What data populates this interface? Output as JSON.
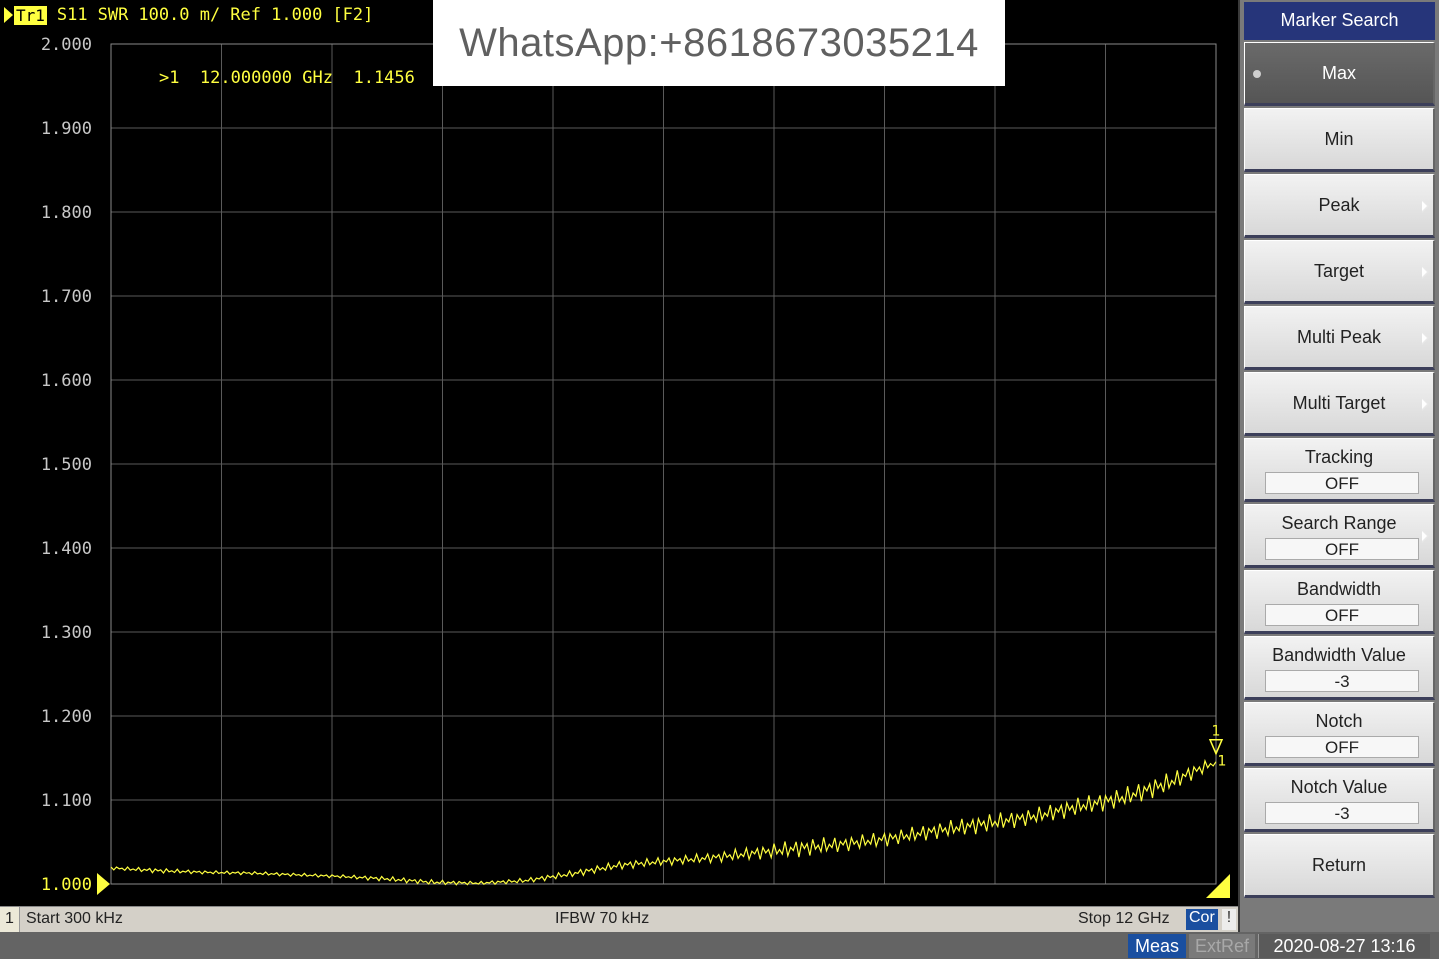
{
  "header": {
    "trace_tag": "Tr1",
    "measurement": "S11",
    "format": "SWR",
    "scale": "100.0 m/",
    "reference": "Ref 1.000",
    "function_key": "[F2]"
  },
  "watermark": "WhatsApp:+8618673035214",
  "marker": {
    "number": ">1",
    "frequency": "12.000000 GHz",
    "value": "1.1456",
    "tag_top": "1",
    "tag_bottom": "1"
  },
  "status_bar": {
    "channel": "1",
    "start": "Start 300 kHz",
    "ifbw": "IFBW 70 kHz",
    "stop": "Stop 12 GHz",
    "correction": "Cor",
    "warning": "!"
  },
  "bottom_bar": {
    "meas": "Meas",
    "extref": "ExtRef",
    "datetime": "2020-08-27 13:16"
  },
  "softkeys": {
    "title": "Marker Search",
    "items": [
      {
        "label": "Max",
        "value": null,
        "submenu": false,
        "active": true
      },
      {
        "label": "Min",
        "value": null,
        "submenu": false,
        "active": false
      },
      {
        "label": "Peak",
        "value": null,
        "submenu": true,
        "active": false
      },
      {
        "label": "Target",
        "value": null,
        "submenu": true,
        "active": false
      },
      {
        "label": "Multi Peak",
        "value": null,
        "submenu": true,
        "active": false
      },
      {
        "label": "Multi Target",
        "value": null,
        "submenu": true,
        "active": false
      },
      {
        "label": "Tracking",
        "value": "OFF",
        "submenu": false,
        "active": false
      },
      {
        "label": "Search Range",
        "value": "OFF",
        "submenu": true,
        "active": false
      },
      {
        "label": "Bandwidth",
        "value": "OFF",
        "submenu": false,
        "active": false
      },
      {
        "label": "Bandwidth Value",
        "value": "-3",
        "submenu": false,
        "active": false
      },
      {
        "label": "Notch",
        "value": "OFF",
        "submenu": false,
        "active": false
      },
      {
        "label": "Notch Value",
        "value": "-3",
        "submenu": false,
        "active": false
      },
      {
        "label": "Return",
        "value": null,
        "submenu": false,
        "active": false
      }
    ]
  },
  "colors": {
    "trace": "#ffff40",
    "grid": "#5a5a5a",
    "axis_label": "#c8c8c8",
    "active_tab": "#26357a"
  },
  "chart_data": {
    "type": "line",
    "title": "",
    "xlabel": "",
    "ylabel": "",
    "xlim_ghz": [
      0.0003,
      12
    ],
    "ylim": [
      1.0,
      2.0
    ],
    "x_divisions": 10,
    "y_ticks": [
      "2.000",
      "1.900",
      "1.800",
      "1.700",
      "1.600",
      "1.500",
      "1.400",
      "1.300",
      "1.200",
      "1.100",
      "1.000"
    ],
    "series": [
      {
        "x_ghz": [
          0.0003,
          0.5,
          1.0,
          1.5,
          2.0,
          2.5,
          3.0,
          3.5,
          4.0,
          4.5,
          5.0,
          5.5,
          6.0,
          6.5,
          7.0,
          7.5,
          8.0,
          8.5,
          9.0,
          9.5,
          10.0,
          10.5,
          11.0,
          11.5,
          12.0
        ],
        "values": [
          1.019,
          1.016,
          1.014,
          1.013,
          1.011,
          1.009,
          1.006,
          1.002,
          1.001,
          1.004,
          1.012,
          1.022,
          1.027,
          1.031,
          1.037,
          1.043,
          1.048,
          1.055,
          1.064,
          1.072,
          1.08,
          1.092,
          1.103,
          1.121,
          1.1456
        ],
        "ripple": [
          0.002,
          0.003,
          0.002,
          0.002,
          0.002,
          0.002,
          0.003,
          0.003,
          0.002,
          0.003,
          0.004,
          0.005,
          0.005,
          0.006,
          0.008,
          0.011,
          0.009,
          0.009,
          0.01,
          0.011,
          0.01,
          0.011,
          0.012,
          0.012,
          0.006
        ]
      }
    ]
  }
}
